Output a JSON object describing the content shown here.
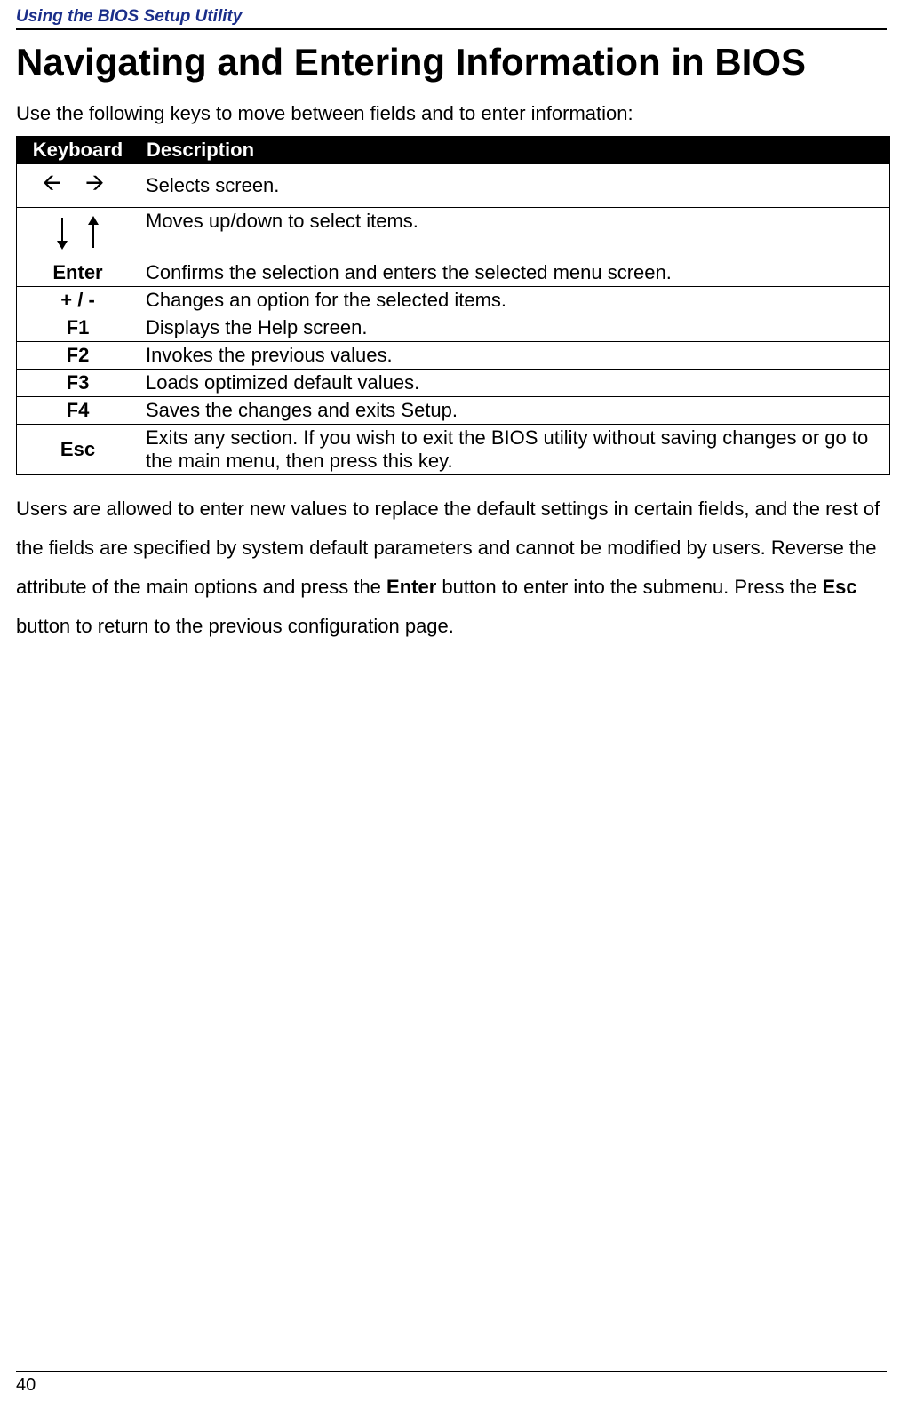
{
  "header": {
    "section_title": "Using the BIOS Setup Utility"
  },
  "title": "Navigating and Entering Information in BIOS",
  "intro": "Use the following keys to move between fields and to enter information:",
  "table": {
    "headers": {
      "keyboard": "Keyboard",
      "description": "Description"
    },
    "rows": [
      {
        "key": "🡨  🡪",
        "desc": "Selects screen."
      },
      {
        "key": "↓ ↑",
        "desc": "Moves up/down to select items."
      },
      {
        "key": "Enter",
        "desc": "Confirms the selection and enters the selected menu screen."
      },
      {
        "key": "+ / -",
        "desc": "Changes an option for the selected items."
      },
      {
        "key": "F1",
        "desc": "Displays the Help screen."
      },
      {
        "key": "F2",
        "desc": "Invokes the previous values."
      },
      {
        "key": "F3",
        "desc": "Loads optimized default values."
      },
      {
        "key": "F4",
        "desc": "Saves the changes and exits Setup."
      },
      {
        "key": "Esc",
        "desc": "Exits any section. If you wish to exit the BIOS utility without saving changes or go to the main menu, then press this key."
      }
    ]
  },
  "body": {
    "p1a": "Users are allowed to enter new values to replace the default settings in certain fields, and the rest of the fields are specified by system default parameters and cannot be modified by users. Reverse the attribute of the main options and press the ",
    "enter": "Enter",
    "p1b": " button to enter into the submenu. Press the ",
    "esc": "Esc",
    "p1c": " button to return to the previous configuration page."
  },
  "page_number": "40"
}
